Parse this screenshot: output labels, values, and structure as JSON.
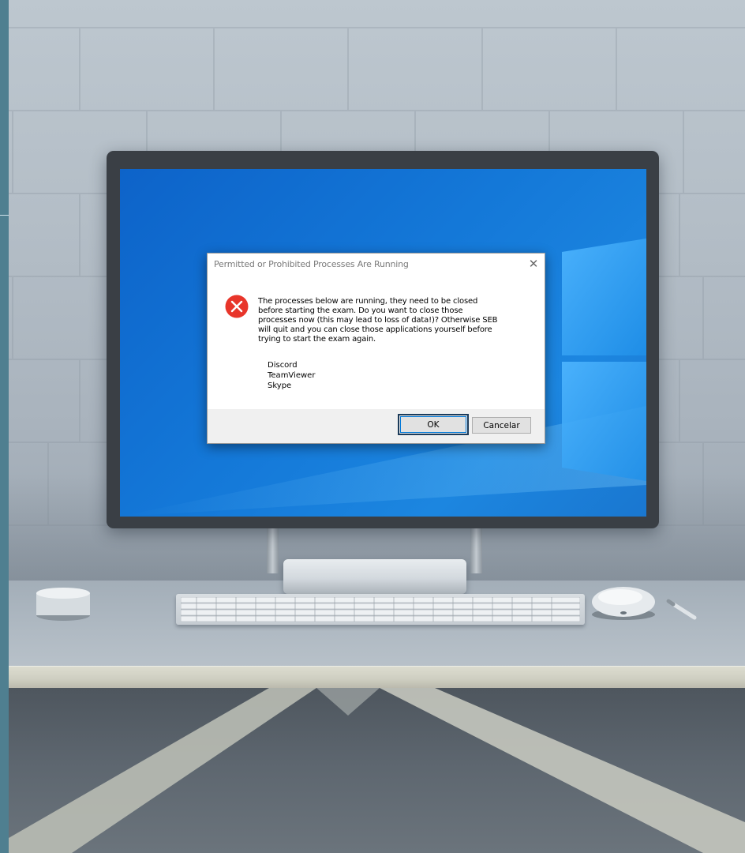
{
  "dialog": {
    "title": "Permitted or Prohibited Processes Are Running",
    "close_glyph": "✕",
    "icon": "error-icon",
    "message_lines": [
      "The processes below are running, they need to be closed",
      "before starting the exam. Do you want to close those",
      "processes now (this may lead to loss of data!)? Otherwise SEB",
      "will quit and you can close those applications yourself before",
      "trying to start the exam again."
    ],
    "processes": [
      "Discord",
      "TeamViewer",
      "Skype"
    ],
    "buttons": {
      "ok_label": "OK",
      "cancel_label": "Cancelar"
    }
  },
  "colors": {
    "desktop_blue": "#1478d8",
    "error_red": "#e8352a",
    "dialog_footer": "#f0f0f0",
    "focus_border": "#1c3b5a"
  }
}
